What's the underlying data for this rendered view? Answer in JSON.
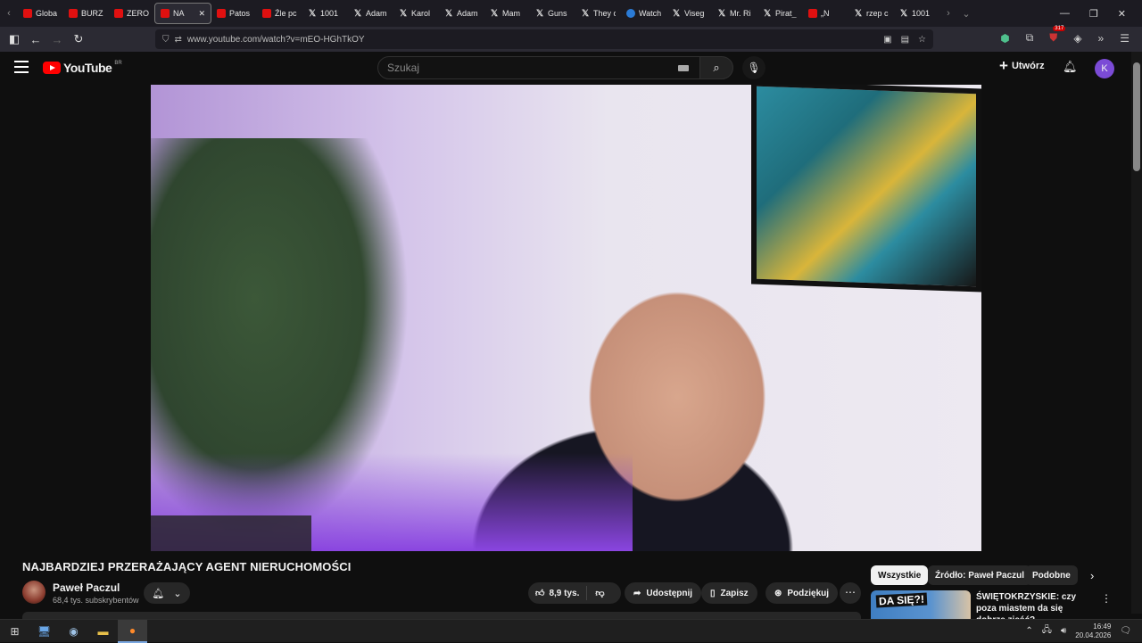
{
  "browser": {
    "tabs": [
      {
        "label": "Globa",
        "kind": "yt"
      },
      {
        "label": "BURZ",
        "kind": "yt"
      },
      {
        "label": "ZERO",
        "kind": "yt"
      },
      {
        "label": "NA",
        "kind": "yt",
        "active": true
      },
      {
        "label": "Patos",
        "kind": "yt"
      },
      {
        "label": "Źle pc",
        "kind": "yt"
      },
      {
        "label": "1001",
        "kind": "x"
      },
      {
        "label": "Adam",
        "kind": "x"
      },
      {
        "label": "Karol",
        "kind": "x"
      },
      {
        "label": "Adam",
        "kind": "x"
      },
      {
        "label": "Mam",
        "kind": "x"
      },
      {
        "label": "Guns",
        "kind": "x"
      },
      {
        "label": "They c",
        "kind": "x"
      },
      {
        "label": "Watch",
        "kind": "tw"
      },
      {
        "label": "Viseg",
        "kind": "x"
      },
      {
        "label": "Mr. Ri",
        "kind": "x"
      },
      {
        "label": "Pirat_",
        "kind": "x"
      },
      {
        "label": "„N",
        "kind": "yt"
      },
      {
        "label": "rzep c",
        "kind": "x"
      },
      {
        "label": "1001",
        "kind": "x"
      }
    ],
    "url": "www.youtube.com/watch?v=mEO-HGhTkOY",
    "extension_badge": "317"
  },
  "youtube": {
    "logo_text": "YouTube",
    "country_code": "BR",
    "search_placeholder": "Szukaj",
    "create_label": "Utwórz",
    "avatar_letter": "K"
  },
  "video": {
    "title": "NAJBARDZIEJ PRZERAŻAJĄCY AGENT NIERUCHOMOŚCI",
    "channel_name": "Paweł Paczul",
    "subscribers": "68,4 tys. subskrybentów",
    "likes": "8,9 tys.",
    "share_label": "Udostępnij",
    "save_label": "Zapisz",
    "thanks_label": "Podziękuj"
  },
  "sidebar": {
    "chips": [
      "Wszystkie",
      "Źródło: Paweł Paczul",
      "Podobne"
    ],
    "recommendation": {
      "thumb_text": "DA SIĘ?!",
      "title": "ŚWIĘTOKRZYSKIE: czy poza miastem da się dobrze zjeść?"
    }
  },
  "taskbar": {
    "time": "16:49",
    "date": "20.04.2026"
  }
}
